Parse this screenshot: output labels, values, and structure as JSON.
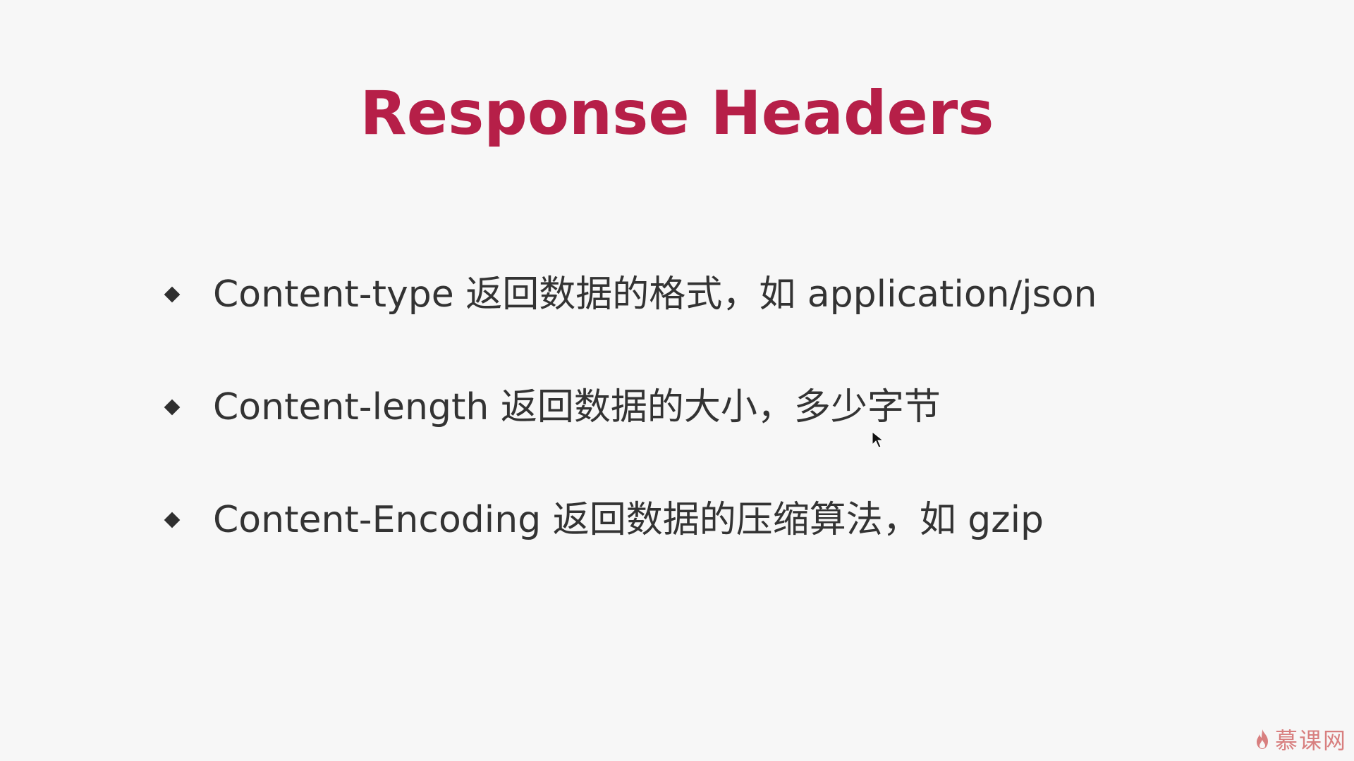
{
  "slide": {
    "title": "Response Headers",
    "bullets": [
      {
        "text": "Content-type 返回数据的格式，如 application/json"
      },
      {
        "text": "Content-length 返回数据的大小，多少字节"
      },
      {
        "text": "Content-Encoding 返回数据的压缩算法，如 gzip"
      }
    ]
  },
  "watermark": {
    "logo_text": "慕课网",
    "icon": "flame-icon"
  },
  "cursor": {
    "icon": "mouse-pointer-icon"
  },
  "colors": {
    "title": "#b61f48",
    "text": "#333333",
    "background": "#f7f7f7",
    "watermark": "#d36b6b"
  }
}
